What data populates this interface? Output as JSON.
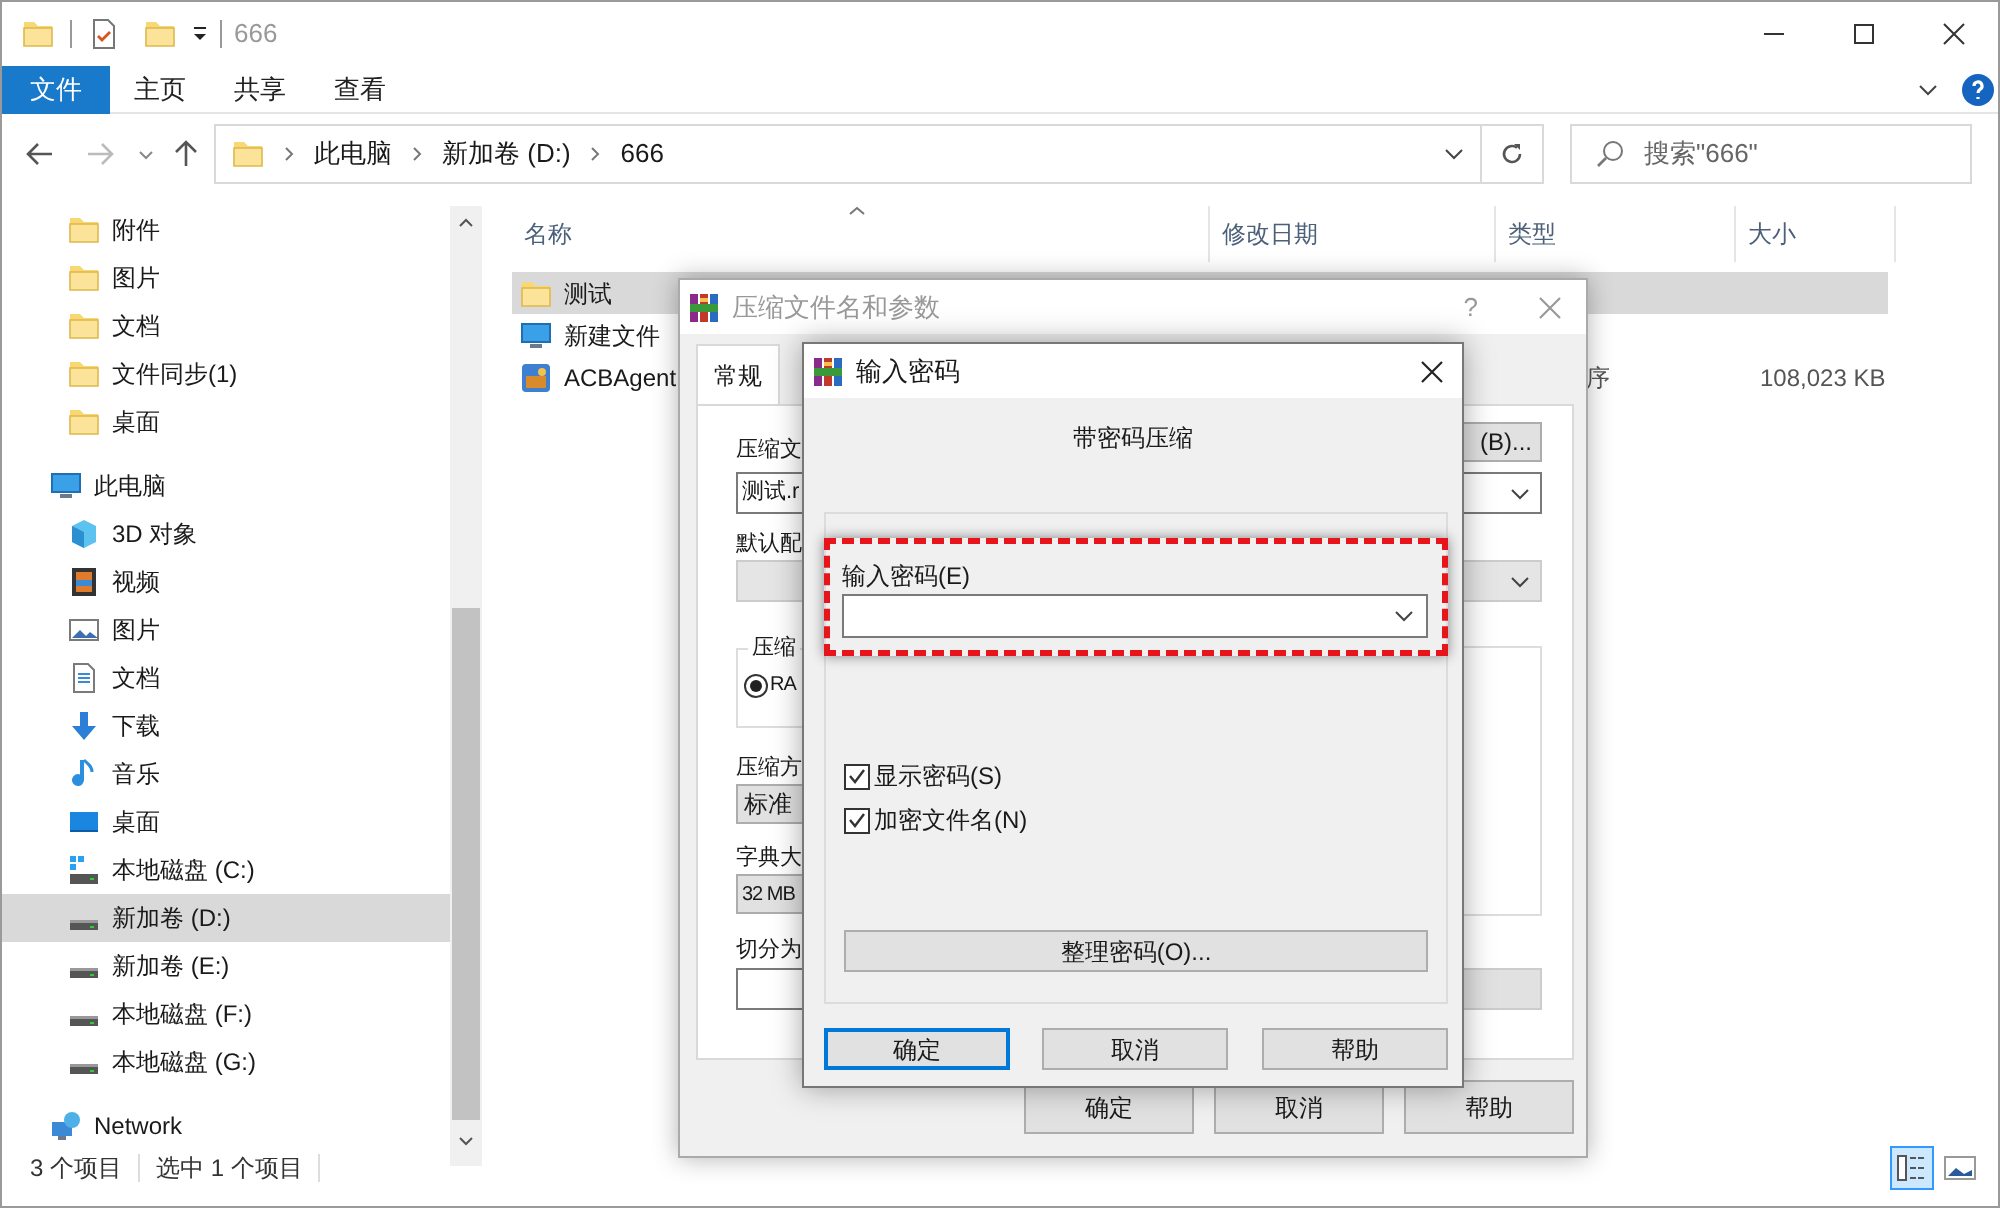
{
  "window": {
    "title": "666"
  },
  "ribbon_tabs": [
    {
      "label": "文件",
      "selected": true
    },
    {
      "label": "主页",
      "selected": false
    },
    {
      "label": "共享",
      "selected": false
    },
    {
      "label": "查看",
      "selected": false
    }
  ],
  "address": {
    "crumbs": [
      "此电脑",
      "新加卷 (D:)",
      "666"
    ]
  },
  "search": {
    "placeholder": "搜索\"666\""
  },
  "sidebar": {
    "groups": [
      {
        "children": [
          {
            "label": "附件",
            "kind": "folder",
            "selected": false
          },
          {
            "label": "图片",
            "kind": "folder",
            "selected": false
          },
          {
            "label": "文档",
            "kind": "folder",
            "selected": false
          },
          {
            "label": "文件同步(1)",
            "kind": "folder",
            "selected": false
          },
          {
            "label": "桌面",
            "kind": "folder",
            "selected": false
          }
        ]
      },
      {
        "label": "此电脑",
        "kind": "pc",
        "selected": false,
        "children": [
          {
            "label": "3D 对象",
            "kind": "cube",
            "selected": false
          },
          {
            "label": "视频",
            "kind": "film",
            "selected": false
          },
          {
            "label": "图片",
            "kind": "image",
            "selected": false
          },
          {
            "label": "文档",
            "kind": "doc",
            "selected": false
          },
          {
            "label": "下载",
            "kind": "download",
            "selected": false
          },
          {
            "label": "音乐",
            "kind": "music",
            "selected": false
          },
          {
            "label": "桌面",
            "kind": "desktop",
            "selected": false
          },
          {
            "label": "本地磁盘 (C:)",
            "kind": "sysdrive",
            "selected": false
          },
          {
            "label": "新加卷 (D:)",
            "kind": "drive",
            "selected": true
          },
          {
            "label": "新加卷 (E:)",
            "kind": "drive",
            "selected": false
          },
          {
            "label": "本地磁盘 (F:)",
            "kind": "drive",
            "selected": false
          },
          {
            "label": "本地磁盘 (G:)",
            "kind": "drive",
            "selected": false
          }
        ]
      },
      {
        "label": "Network",
        "kind": "network",
        "selected": false
      }
    ]
  },
  "table": {
    "columns": [
      "名称",
      "修改日期",
      "类型",
      "大小"
    ],
    "rows": [
      {
        "name": "测试",
        "kind": "folder",
        "selected": true
      },
      {
        "name": "新建文件",
        "kind": "pc",
        "selected": false
      },
      {
        "name": "ACBAgent",
        "kind": "app",
        "type": "序",
        "size": "108,023 KB",
        "selected": false
      }
    ]
  },
  "status_bar": {
    "items": [
      "3 个项目",
      "选中 1 个项目"
    ],
    "views": [
      {
        "kind": "details",
        "selected": true
      },
      {
        "kind": "thumbnails",
        "selected": false
      }
    ]
  },
  "archive_dialog": {
    "title": "压缩文件名和参数",
    "help": "?",
    "tabs": [
      {
        "label": "常规",
        "selected": true
      }
    ],
    "archive_label": "压缩文",
    "browse_button": "(B)...",
    "archive_value": "测试.r",
    "profile_label": "默认配",
    "format_group": "压缩",
    "format_radio": {
      "label": "RA",
      "selected": true
    },
    "method_label": "压缩方",
    "method_value": "标准",
    "dict_label": "字典大",
    "dict_value": "32 MB",
    "split_label": "切分为",
    "buttons": [
      "确定",
      "取消",
      "帮助"
    ]
  },
  "password_dialog": {
    "title": "输入密码",
    "heading": "带密码压缩",
    "password_label": "输入密码(E)",
    "checkboxes": [
      {
        "label": "显示密码(S)",
        "checked": true
      },
      {
        "label": "加密文件名(N)",
        "checked": true
      }
    ],
    "manage_button": "整理密码(O)...",
    "buttons": [
      {
        "label": "确定",
        "focused": true
      },
      {
        "label": "取消",
        "focused": false
      },
      {
        "label": "帮助",
        "focused": false
      }
    ]
  }
}
